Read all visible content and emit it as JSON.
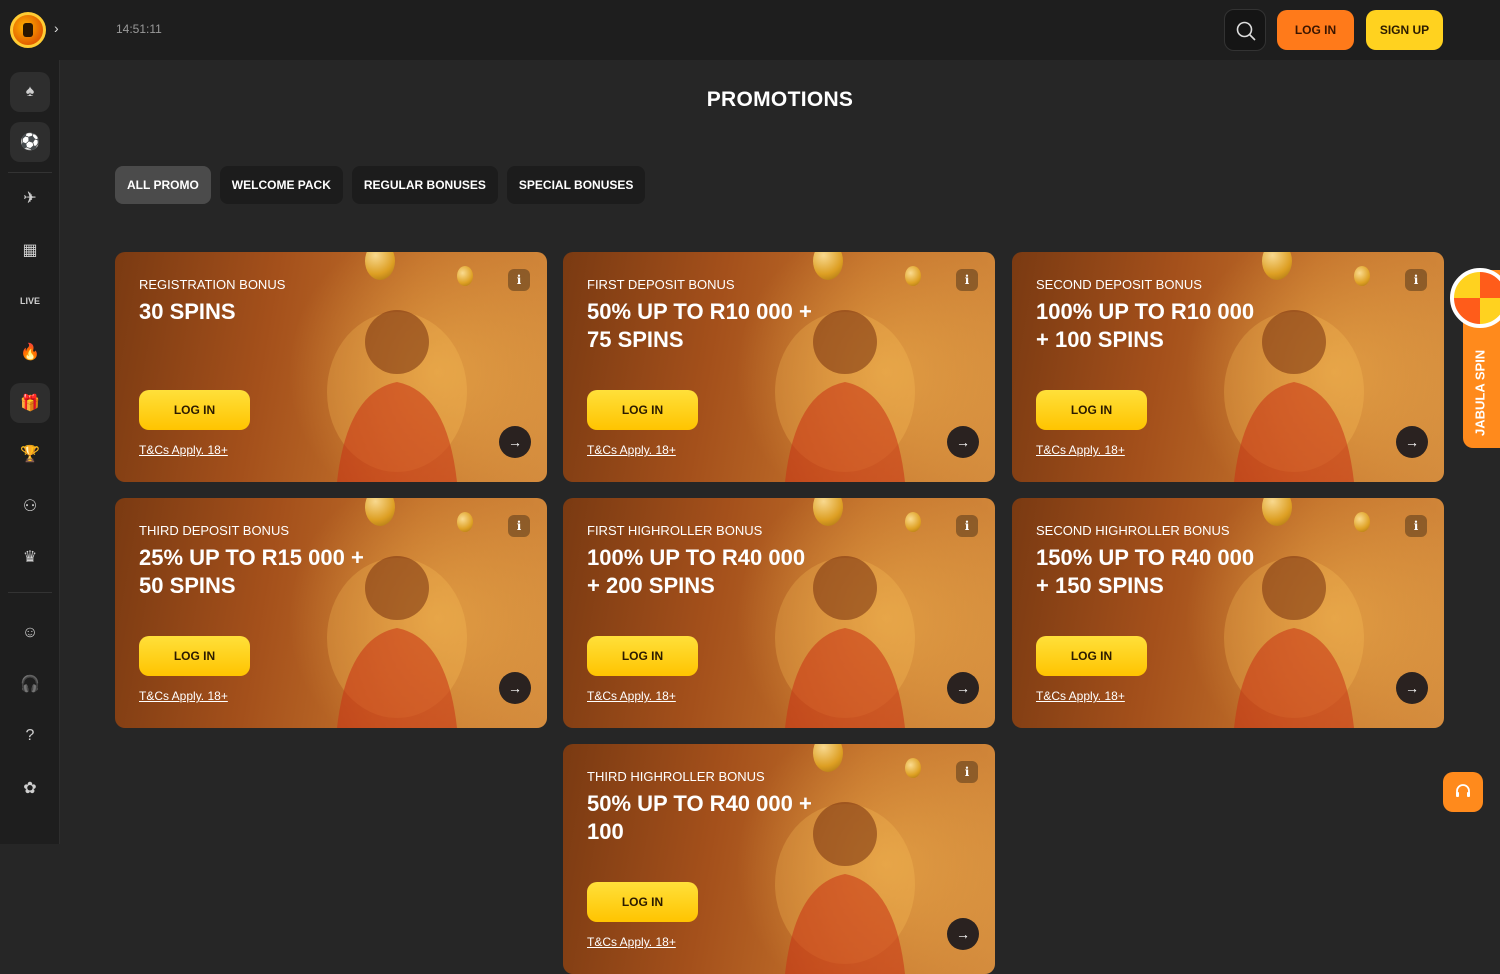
{
  "header": {
    "clock": "14:51:11",
    "login_label": "LOG IN",
    "signup_label": "SIGN UP"
  },
  "sidebar": {
    "items": [
      {
        "icon": "spade-icon"
      },
      {
        "icon": "sports-ball-icon"
      },
      {
        "icon": "aviator-plane-icon"
      },
      {
        "icon": "slots-icon"
      },
      {
        "icon": "live-casino-icon",
        "label": "LIVE"
      },
      {
        "icon": "fire-icon"
      },
      {
        "icon": "promotions-gift-icon"
      },
      {
        "icon": "trophy-icon"
      },
      {
        "icon": "lottery-balls-icon"
      },
      {
        "icon": "crown-icon"
      },
      {
        "icon": "hands-icon"
      },
      {
        "icon": "headset-icon"
      },
      {
        "icon": "help-icon"
      },
      {
        "icon": "paw-icon"
      }
    ]
  },
  "page": {
    "title": "PROMOTIONS"
  },
  "tabs": [
    "ALL PROMO",
    "WELCOME PACK",
    "REGULAR BONUSES",
    "SPECIAL BONUSES"
  ],
  "promos": [
    {
      "category": "REGISTRATION BONUS",
      "headline": "30 SPINS",
      "cta": "LOG IN",
      "terms": "T&Cs Apply. 18+",
      "image": "golden-trophy"
    },
    {
      "category": "FIRST DEPOSIT BONUS",
      "headline": "50% UP TO R10 000 + 75 SPINS",
      "cta": "LOG IN",
      "terms": "T&Cs Apply. 18+",
      "image": "excited-cartoon-man"
    },
    {
      "category": "SECOND DEPOSIT BONUS",
      "headline": "100% UP TO R10 000 + 100 SPINS",
      "cta": "LOG IN",
      "terms": "T&Cs Apply. 18+",
      "image": "man-in-red-suit-with-phone"
    },
    {
      "category": "THIRD DEPOSIT BONUS",
      "headline": "25% UP TO R15 000 + 50 SPINS",
      "cta": "LOG IN",
      "terms": "T&Cs Apply. 18+",
      "image": "woman-in-red-dress"
    },
    {
      "category": "FIRST HIGHROLLER BONUS",
      "headline": "100% UP TO R40 000 + 200 SPINS",
      "cta": "LOG IN",
      "terms": "T&Cs Apply. 18+",
      "image": "man-in-gold-suit"
    },
    {
      "category": "SECOND HIGHROLLER BONUS",
      "headline": "150% UP TO R40 000 + 150 SPINS",
      "cta": "LOG IN",
      "terms": "T&Cs Apply. 18+",
      "image": "vault-with-gold-coins"
    },
    {
      "category": "THIRD HIGHROLLER BONUS",
      "headline": "50% UP TO R40 000 + 100",
      "cta": "LOG IN",
      "terms": "T&Cs Apply. 18+",
      "image": "coins"
    }
  ],
  "side_widget": {
    "label": "JABULA SPIN"
  },
  "colors": {
    "accent_orange": "#ff7a1a",
    "accent_yellow": "#ffd21f",
    "background": "#262626"
  }
}
